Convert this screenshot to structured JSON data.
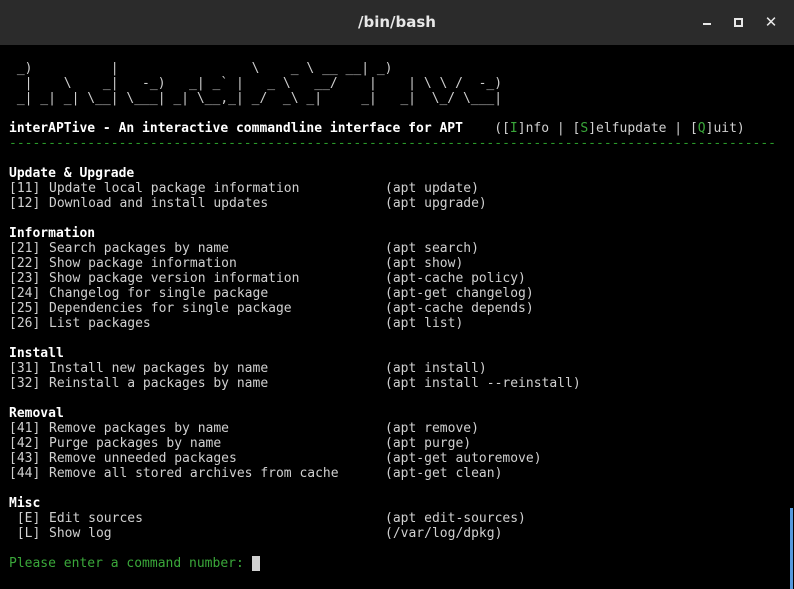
{
  "window": {
    "title": "/bin/bash",
    "minimize": "",
    "maximize": "",
    "close": "✕"
  },
  "banner": [
    " _)          |                 \\    _ \\ __ __| _)",
    "  |    \\    _|   -_)   _| _` |   _ \\   __/    |    | \\ \\ /  -_)",
    " _| _| _| \\__| \\___| _| \\__,_| _/  _\\ _|     _|   _|  \\_/ \\___|"
  ],
  "header": {
    "title": "interAPTive - An interactive commandline interface for APT",
    "info_open": "(",
    "info_key": "I",
    "info_rest": "nfo",
    "self_key": "S",
    "self_rest": "elfupdate",
    "quit_key": "Q",
    "quit_rest": "uit)",
    "pipe": " | "
  },
  "separator": "--------------------------------------------------------------------------------------------------",
  "sections": [
    {
      "title": "Update & Upgrade",
      "items": [
        {
          "num": "[11]",
          "desc": "Update local package information",
          "cmd": "(apt update)"
        },
        {
          "num": "[12]",
          "desc": "Download and install updates",
          "cmd": "(apt upgrade)"
        }
      ]
    },
    {
      "title": "Information",
      "items": [
        {
          "num": "[21]",
          "desc": "Search packages by name",
          "cmd": "(apt search)"
        },
        {
          "num": "[22]",
          "desc": "Show package information",
          "cmd": "(apt show)"
        },
        {
          "num": "[23]",
          "desc": "Show package version information",
          "cmd": "(apt-cache policy)"
        },
        {
          "num": "[24]",
          "desc": "Changelog for single package",
          "cmd": "(apt-get changelog)"
        },
        {
          "num": "[25]",
          "desc": "Dependencies for single package",
          "cmd": "(apt-cache depends)"
        },
        {
          "num": "[26]",
          "desc": "List packages",
          "cmd": "(apt list)"
        }
      ]
    },
    {
      "title": "Install",
      "items": [
        {
          "num": "[31]",
          "desc": "Install new packages by name",
          "cmd": "(apt install)"
        },
        {
          "num": "[32]",
          "desc": "Reinstall a packages by name",
          "cmd": "(apt install --reinstall)"
        }
      ]
    },
    {
      "title": "Removal",
      "items": [
        {
          "num": "[41]",
          "desc": "Remove packages by name",
          "cmd": "(apt remove)"
        },
        {
          "num": "[42]",
          "desc": "Purge packages by name",
          "cmd": "(apt purge)"
        },
        {
          "num": "[43]",
          "desc": "Remove unneeded packages",
          "cmd": "(apt-get autoremove)"
        },
        {
          "num": "[44]",
          "desc": "Remove all stored archives from cache",
          "cmd": "(apt-get clean)"
        }
      ]
    },
    {
      "title": "Misc",
      "items": [
        {
          "num": " [E]",
          "desc": "Edit sources",
          "cmd": "(apt edit-sources)"
        },
        {
          "num": " [L]",
          "desc": "Show log",
          "cmd": "(/var/log/dpkg)"
        }
      ]
    }
  ],
  "prompt": "Please enter a command number: ",
  "colors": {
    "background": "#000000",
    "titlebar": "#2b2b2b",
    "text": "#d0d0d0",
    "accent_green": "#3aa83a",
    "scrollbar": "#5599dd"
  }
}
